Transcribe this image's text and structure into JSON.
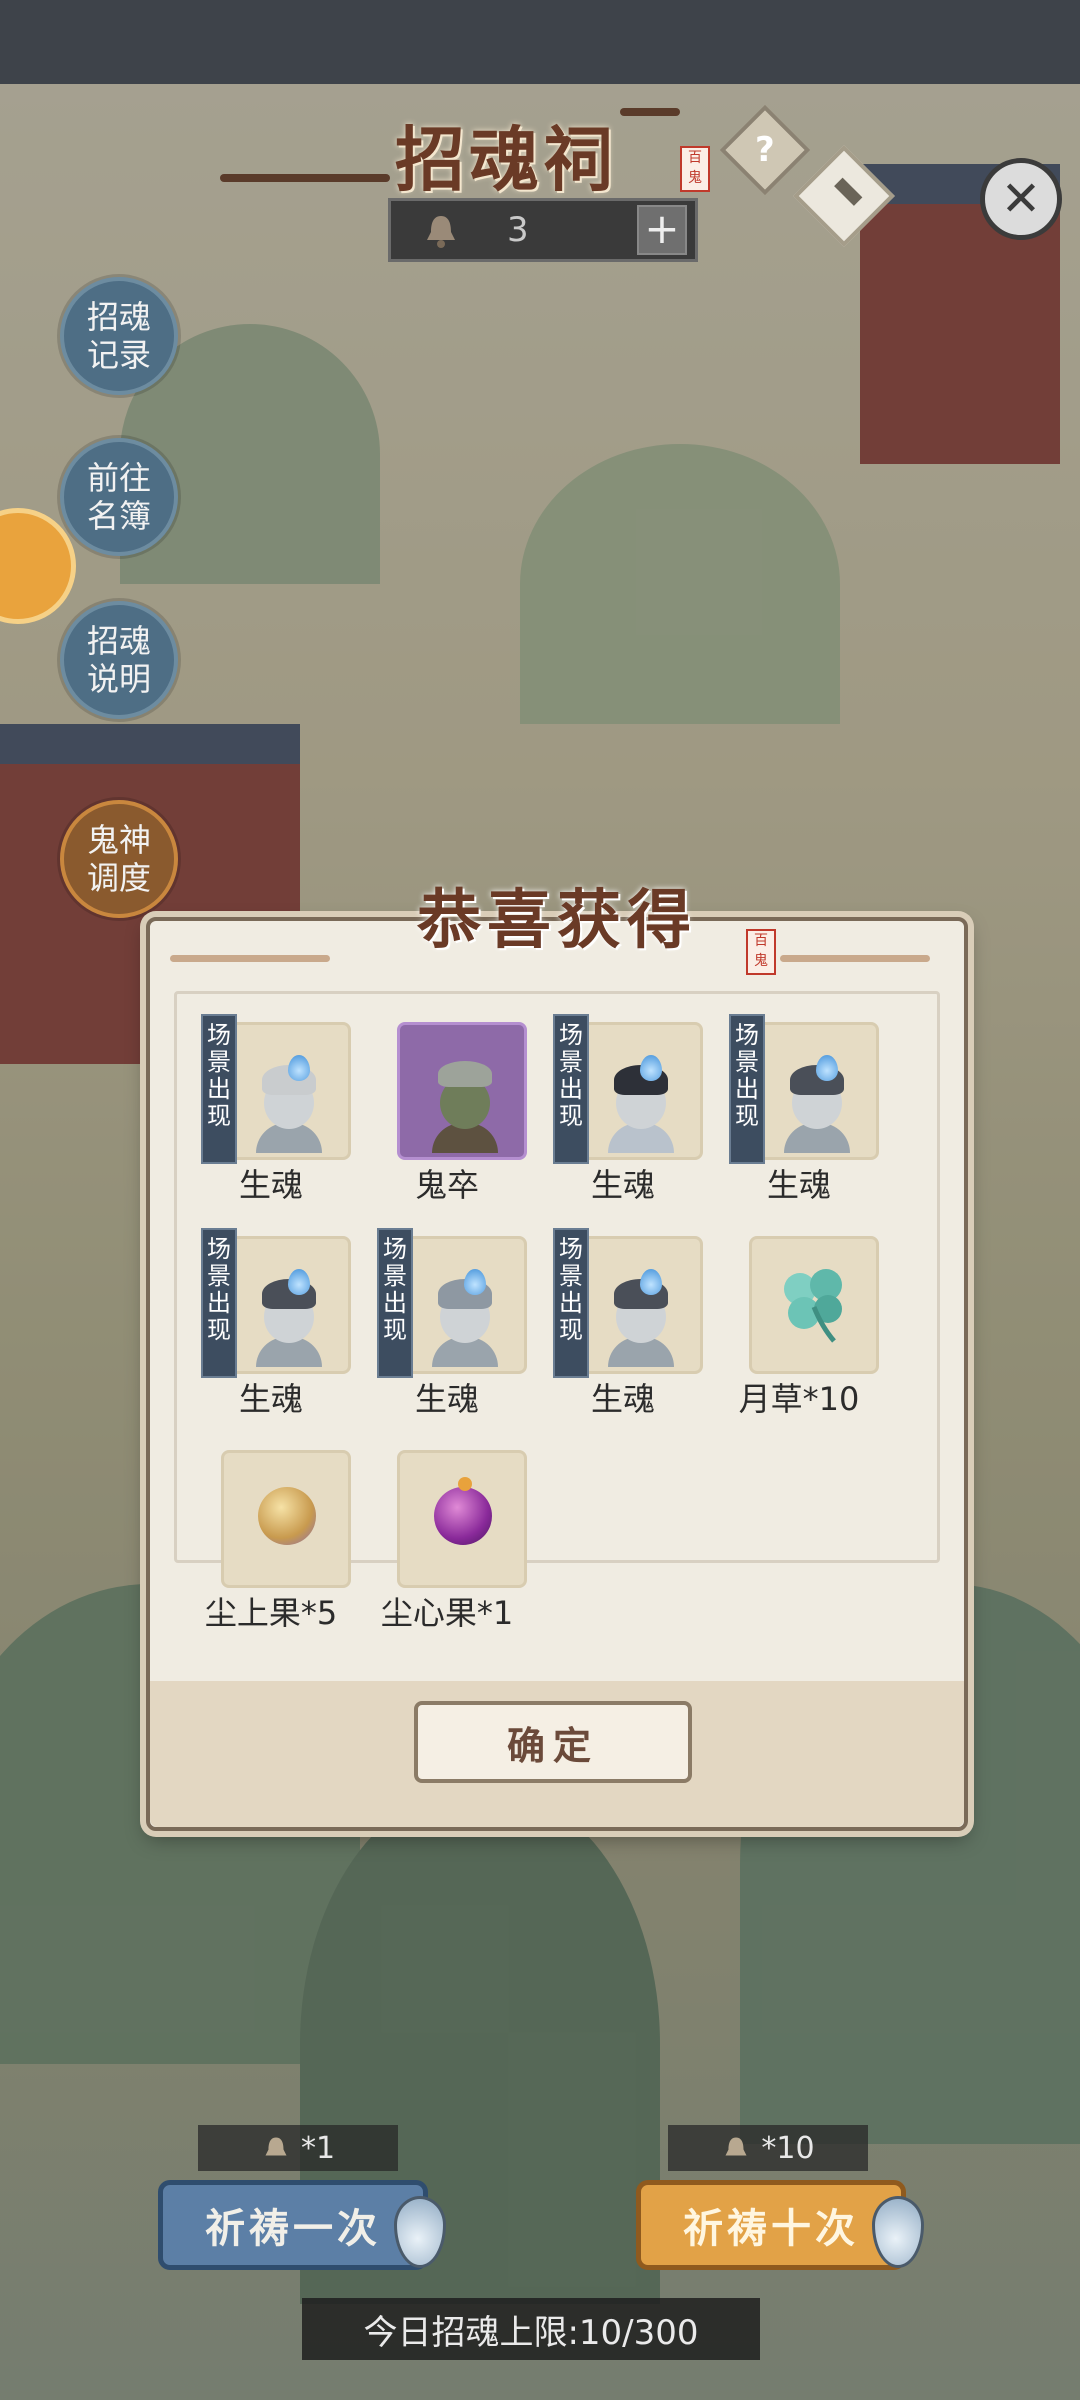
{
  "header": {
    "title": "招魂祠",
    "seal_text": "百鬼",
    "help_label": "?",
    "close_label": "✕",
    "counter_value": "3",
    "plus_label": "+"
  },
  "side_menu": [
    {
      "label": "招魂记录"
    },
    {
      "label": "前往名簿"
    },
    {
      "label": "招魂说明"
    },
    {
      "label": "鬼神调度"
    }
  ],
  "modal": {
    "title": "恭喜获得",
    "seal_text": "百鬼",
    "tag_text": "场景出现",
    "items": [
      {
        "label": "生魂",
        "tag": true
      },
      {
        "label": "鬼卒",
        "tag": false
      },
      {
        "label": "生魂",
        "tag": true
      },
      {
        "label": "生魂",
        "tag": true
      },
      {
        "label": "生魂",
        "tag": true
      },
      {
        "label": "生魂",
        "tag": true
      },
      {
        "label": "生魂",
        "tag": true
      },
      {
        "label": "月草*10",
        "tag": false
      },
      {
        "label": "尘上果*5",
        "tag": false
      },
      {
        "label": "尘心果*1",
        "tag": false
      }
    ],
    "confirm_label": "确定"
  },
  "bottom": {
    "cost_one": "*1",
    "cost_ten": "*10",
    "pray_once_label": "祈祷一次",
    "pray_ten_label": "祈祷十次",
    "daily_limit": "今日招魂上限:10/300"
  },
  "icons": {
    "bell": "bell-icon",
    "help": "question-icon",
    "hammer": "hammer-icon",
    "close": "close-icon"
  }
}
